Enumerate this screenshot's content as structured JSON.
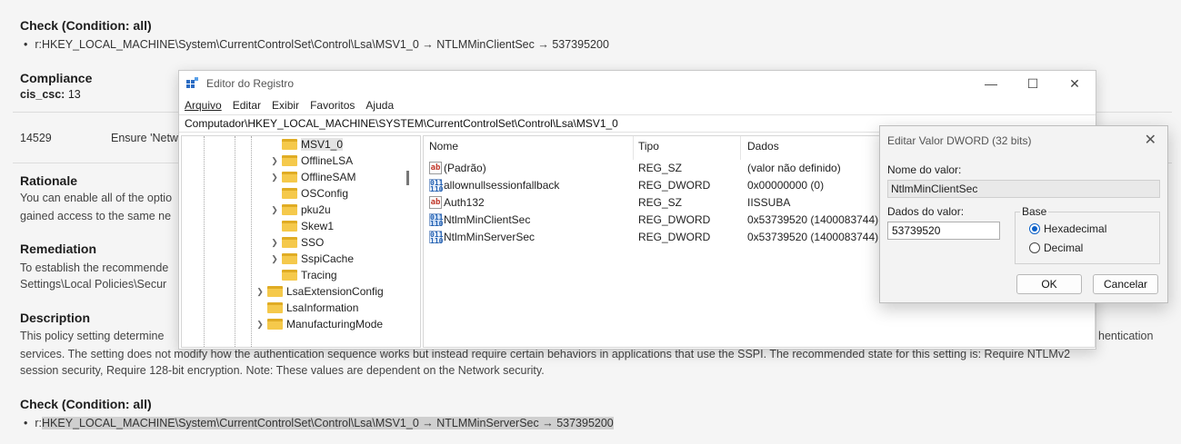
{
  "doc": {
    "check1": {
      "heading": "Check (Condition: all)",
      "item": "r:HKEY_LOCAL_MACHINE\\System\\CurrentControlSet\\Control\\Lsa\\MSV1_0 → NTLMMinClientSec → 537395200"
    },
    "compliance": {
      "heading": "Compliance",
      "label": "cis_csc:",
      "value": "13"
    },
    "row": {
      "id": "14529",
      "text": "Ensure 'Netw"
    },
    "rationale": {
      "heading": "Rationale",
      "line1": "You can enable all of the optio",
      "line2": "gained access to the same ne"
    },
    "remediation": {
      "heading": "Remediation",
      "line1": "To establish the recommende",
      "line2": "Settings\\Local Policies\\Secur"
    },
    "description": {
      "heading": "Description",
      "line1_left": "This policy setting determine",
      "line1_right": "hentication",
      "line2": "services. The setting does not modify how the authentication sequence works but instead require certain behaviors in applications that use the SSPI. The recommended state for this setting is: Require NTLMv2",
      "line3": "session security, Require 128-bit encryption. Note: These values are dependent on the Network security."
    },
    "check2": {
      "heading": "Check (Condition: all)",
      "prefix": "r:",
      "highlight": "HKEY_LOCAL_MACHINE\\System\\CurrentControlSet\\Control\\Lsa\\MSV1_0 → NTLMMinServerSec → 537395200"
    }
  },
  "regedit": {
    "title": "Editor do Registro",
    "menu": [
      "Arquivo",
      "Editar",
      "Exibir",
      "Favoritos",
      "Ajuda"
    ],
    "address": "Computador\\HKEY_LOCAL_MACHINE\\SYSTEM\\CurrentControlSet\\Control\\Lsa\\MSV1_0",
    "tree": [
      "MSV1_0",
      "OfflineLSA",
      "OfflineSAM",
      "OSConfig",
      "pku2u",
      "Skew1",
      "SSO",
      "SspiCache",
      "Tracing",
      "LsaExtensionConfig",
      "LsaInformation",
      "ManufacturingMode"
    ],
    "columns": {
      "name": "Nome",
      "type": "Tipo",
      "data": "Dados"
    },
    "rows": [
      {
        "icon": "ab",
        "name": "(Padrão)",
        "type": "REG_SZ",
        "data": "(valor não definido)"
      },
      {
        "icon": "dword",
        "name": "allownullsessionfallback",
        "type": "REG_DWORD",
        "data": "0x00000000 (0)"
      },
      {
        "icon": "ab",
        "name": "Auth132",
        "type": "REG_SZ",
        "data": "IISSUBA"
      },
      {
        "icon": "dword",
        "name": "NtlmMinClientSec",
        "type": "REG_DWORD",
        "data": "0x53739520 (1400083744)"
      },
      {
        "icon": "dword",
        "name": "NtlmMinServerSec",
        "type": "REG_DWORD",
        "data": "0x53739520 (1400083744)"
      }
    ]
  },
  "dialog": {
    "title": "Editar Valor DWORD (32 bits)",
    "name_label": "Nome do valor:",
    "name_value": "NtlmMinClientSec",
    "data_label": "Dados do valor:",
    "data_value": "53739520",
    "base_label": "Base",
    "hex_label": "Hexadecimal",
    "dec_label": "Decimal",
    "ok": "OK",
    "cancel": "Cancelar"
  }
}
